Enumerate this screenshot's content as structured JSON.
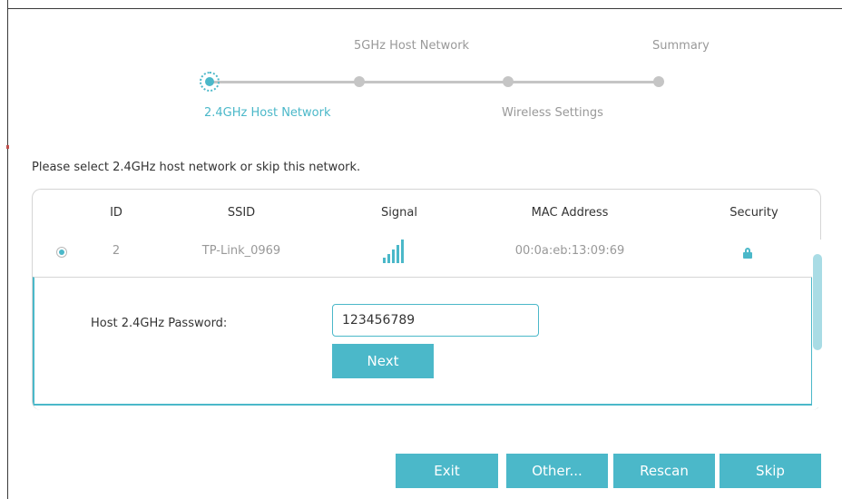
{
  "stepper": {
    "steps": [
      {
        "label": "2.4GHz Host Network",
        "state": "active"
      },
      {
        "label": "5GHz Host Network",
        "state": "pending"
      },
      {
        "label": "Wireless Settings",
        "state": "pending"
      },
      {
        "label": "Summary",
        "state": "pending"
      }
    ]
  },
  "instruction": "Please select 2.4GHz host network or skip this network.",
  "table": {
    "headers": [
      "ID",
      "SSID",
      "Signal",
      "MAC Address",
      "Security"
    ],
    "rows": [
      {
        "selected": true,
        "id": "2",
        "ssid": "TP-Link_0969",
        "signal_bars": 5,
        "mac": "00:0a:eb:13:09:69",
        "security": "lock-icon"
      }
    ]
  },
  "password_panel": {
    "label": "Host 2.4GHz Password:",
    "value": "123456789",
    "next_label": "Next"
  },
  "buttons": {
    "exit": "Exit",
    "other": "Other...",
    "rescan": "Rescan",
    "skip": "Skip"
  },
  "colors": {
    "accent": "#4bb8c9",
    "inactive": "#c5c5c5"
  }
}
